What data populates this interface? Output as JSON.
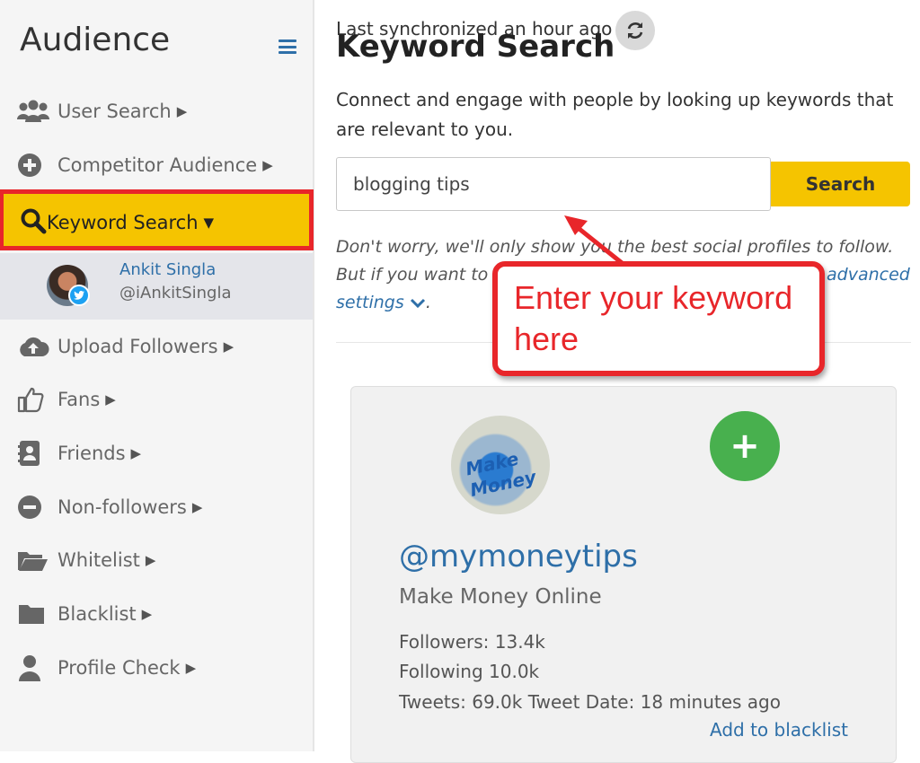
{
  "sidebar": {
    "title": "Audience",
    "items": [
      {
        "label": "User Search",
        "icon": "users-icon"
      },
      {
        "label": "Competitor Audience",
        "icon": "plus-circle-icon"
      },
      {
        "label": "Keyword Search",
        "icon": "search-icon",
        "active": true
      },
      {
        "label": "Upload Followers",
        "icon": "cloud-upload-icon"
      },
      {
        "label": "Fans",
        "icon": "thumbs-up-icon"
      },
      {
        "label": "Friends",
        "icon": "address-book-icon"
      },
      {
        "label": "Non-followers",
        "icon": "minus-circle-icon"
      },
      {
        "label": "Whitelist",
        "icon": "folder-open-icon"
      },
      {
        "label": "Blacklist",
        "icon": "folder-icon"
      },
      {
        "label": "Profile Check",
        "icon": "user-icon"
      }
    ],
    "user": {
      "name": "Ankit Singla",
      "handle": "@iAnkitSingla"
    },
    "caret_right": "▶",
    "caret_down": "▼"
  },
  "main": {
    "sync_text": "Last synchronized an hour ago",
    "title": "Keyword Search",
    "intro": "Connect and engage with people by looking up keywords that are relevant to you.",
    "search_value": "blogging tips",
    "search_button": "Search",
    "note_line1": "Don't worry, we'll only show you the best social profiles to follow.",
    "note_line2_start": "But if you want to",
    "note_link_end": "advanced",
    "note_link_settings": "settings",
    "note_period": "."
  },
  "callout": {
    "line1": "Enter your keyword",
    "line2": "here"
  },
  "card": {
    "avatar_text": "Make Money",
    "follow_symbol": "+",
    "handle": "@mymoneytips",
    "name": "Make Money Online",
    "followers": "Followers: 13.4k",
    "following": "Following 10.0k",
    "tweets": "Tweets: 69.0k Tweet Date: 18 minutes ago",
    "blacklist_link": "Add to blacklist"
  },
  "colors": {
    "accent": "#f5c400",
    "link": "#2e6fa8",
    "callout": "#e8262a",
    "follow": "#48b04e"
  }
}
